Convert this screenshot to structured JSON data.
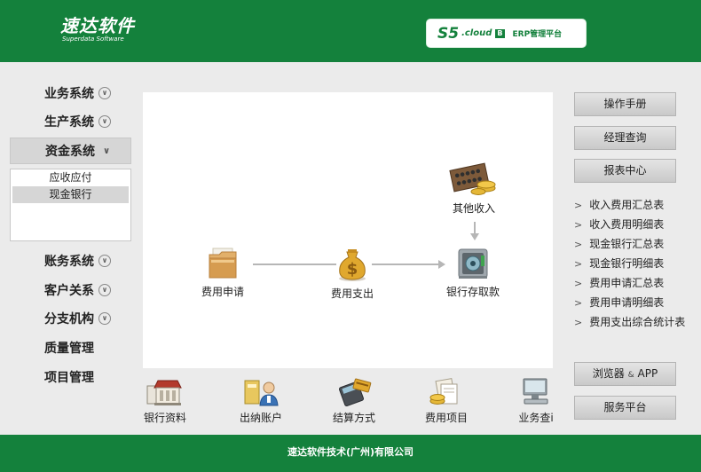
{
  "header": {
    "logo_cn": "速达软件",
    "logo_en": "Superdata Software",
    "product_s5": "S5",
    "product_cloud": ".cloud",
    "product_badge": "B",
    "product_erp": "ERP管理平台",
    "brand_color": "#14813c"
  },
  "nav": {
    "items": [
      {
        "label": "业务系统",
        "icon": "chevron-down-circle-icon"
      },
      {
        "label": "生产系统",
        "icon": "chevron-down-circle-icon"
      },
      {
        "label": "资金系统",
        "icon": "chevron-down-icon"
      },
      {
        "label": "账务系统",
        "icon": "chevron-down-circle-icon"
      },
      {
        "label": "客户关系",
        "icon": "chevron-down-circle-icon"
      },
      {
        "label": "分支机构",
        "icon": "chevron-down-circle-icon"
      },
      {
        "label": "质量管理"
      },
      {
        "label": "项目管理"
      }
    ],
    "sub_items": [
      "应收应付",
      "现金银行"
    ]
  },
  "flow": {
    "nodes": [
      {
        "label": "费用申请",
        "icon": "folder-icon"
      },
      {
        "label": "费用支出",
        "icon": "money-bag-icon"
      },
      {
        "label": "银行存取款",
        "icon": "atm-icon"
      },
      {
        "label": "其他收入",
        "icon": "abacus-coins-icon"
      }
    ]
  },
  "bottom": {
    "items": [
      {
        "label": "银行资料",
        "icon": "bank-icon"
      },
      {
        "label": "出纳账户",
        "icon": "cashier-icon"
      },
      {
        "label": "结算方式",
        "icon": "card-terminal-icon"
      },
      {
        "label": "费用项目",
        "icon": "expense-items-icon"
      },
      {
        "label": "业务查i",
        "icon": "monitor-icon"
      }
    ]
  },
  "right": {
    "manual": "操作手册",
    "manager_query": "经理查询",
    "report_center": "报表中心",
    "reports": [
      "收入费用汇总表",
      "收入费用明细表",
      "现金银行汇总表",
      "现金银行明细表",
      "费用申请汇总表",
      "费用申请明细表",
      "费用支出综合统计表"
    ],
    "browser_a": "浏览器",
    "browser_amp": "&",
    "browser_b": "APP",
    "service": "服务平台"
  },
  "footer": {
    "company": "速达软件技术(广州)有限公司"
  }
}
